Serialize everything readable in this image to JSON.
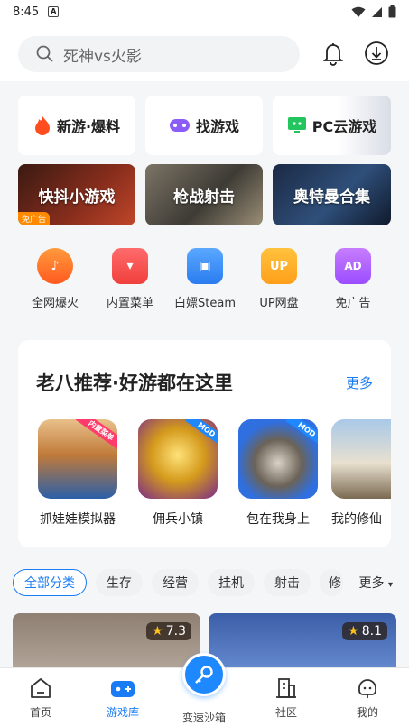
{
  "status": {
    "time": "8:45",
    "badge": "A"
  },
  "search": {
    "placeholder": "死神vs火影"
  },
  "tiles_top": [
    {
      "label": "新游·爆料"
    },
    {
      "label": "找游戏"
    },
    {
      "label": "PC云游戏"
    }
  ],
  "tiles_banner": [
    {
      "label": "快抖小游戏",
      "tag": "免广告"
    },
    {
      "label": "枪战射击"
    },
    {
      "label": "奥特曼合集"
    }
  ],
  "quick": [
    {
      "label": "全网爆火"
    },
    {
      "label": "内置菜单"
    },
    {
      "label": "白嫖Steam"
    },
    {
      "label": "UP网盘"
    },
    {
      "label": "免广告"
    }
  ],
  "recommend": {
    "title": "老八推荐·好游都在这里",
    "more": "更多",
    "games": [
      {
        "name": "抓娃娃模拟器",
        "badge": "内置菜单"
      },
      {
        "name": "佣兵小镇",
        "badge": "MOD"
      },
      {
        "name": "包在我身上",
        "badge": "MOD"
      },
      {
        "name": "我的修仙"
      }
    ]
  },
  "categories": [
    "全部分类",
    "生存",
    "经营",
    "挂机",
    "射击",
    "修"
  ],
  "categories_more": "更多",
  "cards": [
    {
      "rating": "7.3"
    },
    {
      "rating": "8.1"
    }
  ],
  "nav": [
    {
      "label": "首页"
    },
    {
      "label": "游戏库"
    },
    {
      "label": "变速沙箱"
    },
    {
      "label": "社区"
    },
    {
      "label": "我的"
    }
  ],
  "colors": {
    "accent": "#1a7cf5",
    "star": "#ffc21a"
  }
}
